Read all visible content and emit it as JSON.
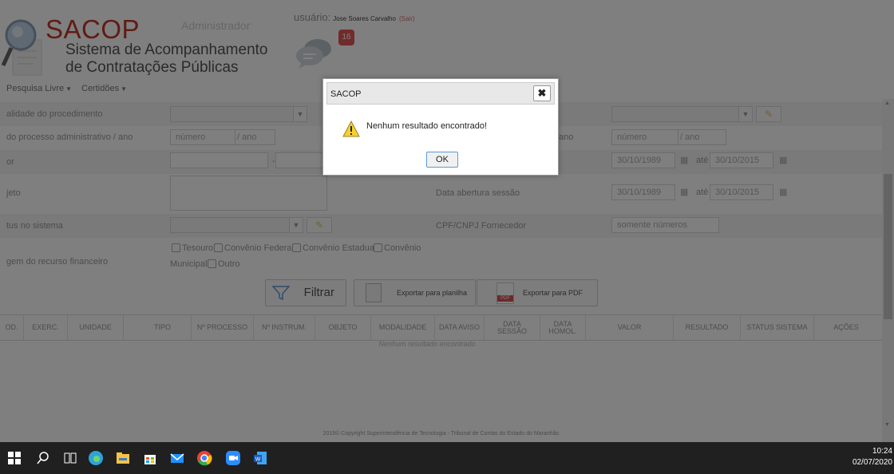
{
  "header": {
    "brand": "SACOP",
    "subtitle_line1": "Sistema de Acompanhamento",
    "subtitle_line2": "de Contratações Públicas",
    "role": "Administrador",
    "user_label": "usuário:",
    "user_name": "Jose Soares Carvalho",
    "logout": "(Sair)",
    "notification_count": "16"
  },
  "nav": {
    "items": [
      {
        "label": "Pesquisa Livre"
      },
      {
        "label": "Certidões"
      }
    ]
  },
  "form": {
    "modalidade_label": "alidade do procedimento",
    "processo_label": "do processo administrativo / ano",
    "processo_numero": "número",
    "processo_ano": "/ ano",
    "valor_label": "or",
    "valor_sep": "-",
    "objeto_label": "jeto",
    "status_label": "tus no sistema",
    "origem_label": "gem do recurso financeiro",
    "origem_options": [
      "Tesouro",
      "Convênio Federal",
      "Convênio Estadual",
      "Convênio"
    ],
    "origem_options_line2": [
      "Municipal",
      "Outro"
    ],
    "right_proc_label_fragment": "ano",
    "right_numero": "número",
    "right_ano": "/ ano",
    "date_from_1": "30/10/1989",
    "date_to_1": "30/10/2015",
    "ate": "até",
    "data_abertura_label": "Data abertura sessão",
    "date_from_2": "30/10/1989",
    "date_to_2": "30/10/2015",
    "cpf_label": "CPF/CNPJ Fornecedor",
    "cpf_placeholder": "somente números"
  },
  "actions": {
    "filter": "Filtrar",
    "export_sheet": "Exportar para planilha",
    "export_pdf": "Exportar para PDF",
    "pdf_tag": "PDF"
  },
  "table": {
    "columns": [
      "OD.",
      "EXERC.",
      "UNIDADE",
      "TIPO",
      "Nº PROCESSO",
      "Nº INSTRUM.",
      "OBJETO",
      "MODALIDADE",
      "DATA AVISO",
      "DATA SESSÃO",
      "DATA HOMOL.",
      "VALOR",
      "RESULTADO",
      "STATUS SISTEMA",
      "AÇÕES"
    ],
    "empty_message": "Nenhum resultado encontrado"
  },
  "footer": {
    "copyright": "2015© Copyright   Superintendência de Tecnologia - Tribunal de Contas do Estado do Maranhão"
  },
  "dialog": {
    "title": "SACOP",
    "message": "Nenhum resultado encontrado!",
    "ok": "OK"
  },
  "taskbar": {
    "time": "10:24",
    "date": "02/07/2020"
  },
  "colors": {
    "brand_red": "#c0392b",
    "badge": "#e45757",
    "taskbar": "#202020"
  }
}
